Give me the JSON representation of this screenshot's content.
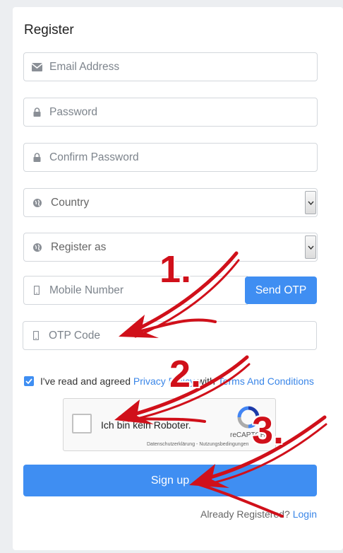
{
  "form": {
    "title": "Register",
    "email_placeholder": "Email Address",
    "password_placeholder": "Password",
    "confirm_password_placeholder": "Confirm Password",
    "country_placeholder": "Country",
    "register_as_placeholder": "Register as",
    "mobile_placeholder": "Mobile Number",
    "send_otp_label": "Send OTP",
    "otp_placeholder": "OTP Code",
    "agree_prefix": "I've read and agreed",
    "privacy_link": "Privacy Policy",
    "agree_with": "with",
    "terms_link": "Terms And Conditions",
    "agree_checked": true,
    "signup_label": "Sign up",
    "already_text": "Already Registered?",
    "login_link": "Login"
  },
  "captcha": {
    "label": "Ich bin kein Roboter.",
    "brand": "reCAPTCHA",
    "links": "Datenschutzerklärung - Nutzungsbedingungen"
  },
  "annotations": {
    "step1": "1.",
    "step2": "2.",
    "step3": "3.",
    "color": "#d0101a"
  },
  "colors": {
    "accent": "#3f8ef2",
    "link": "#3a86e8"
  }
}
